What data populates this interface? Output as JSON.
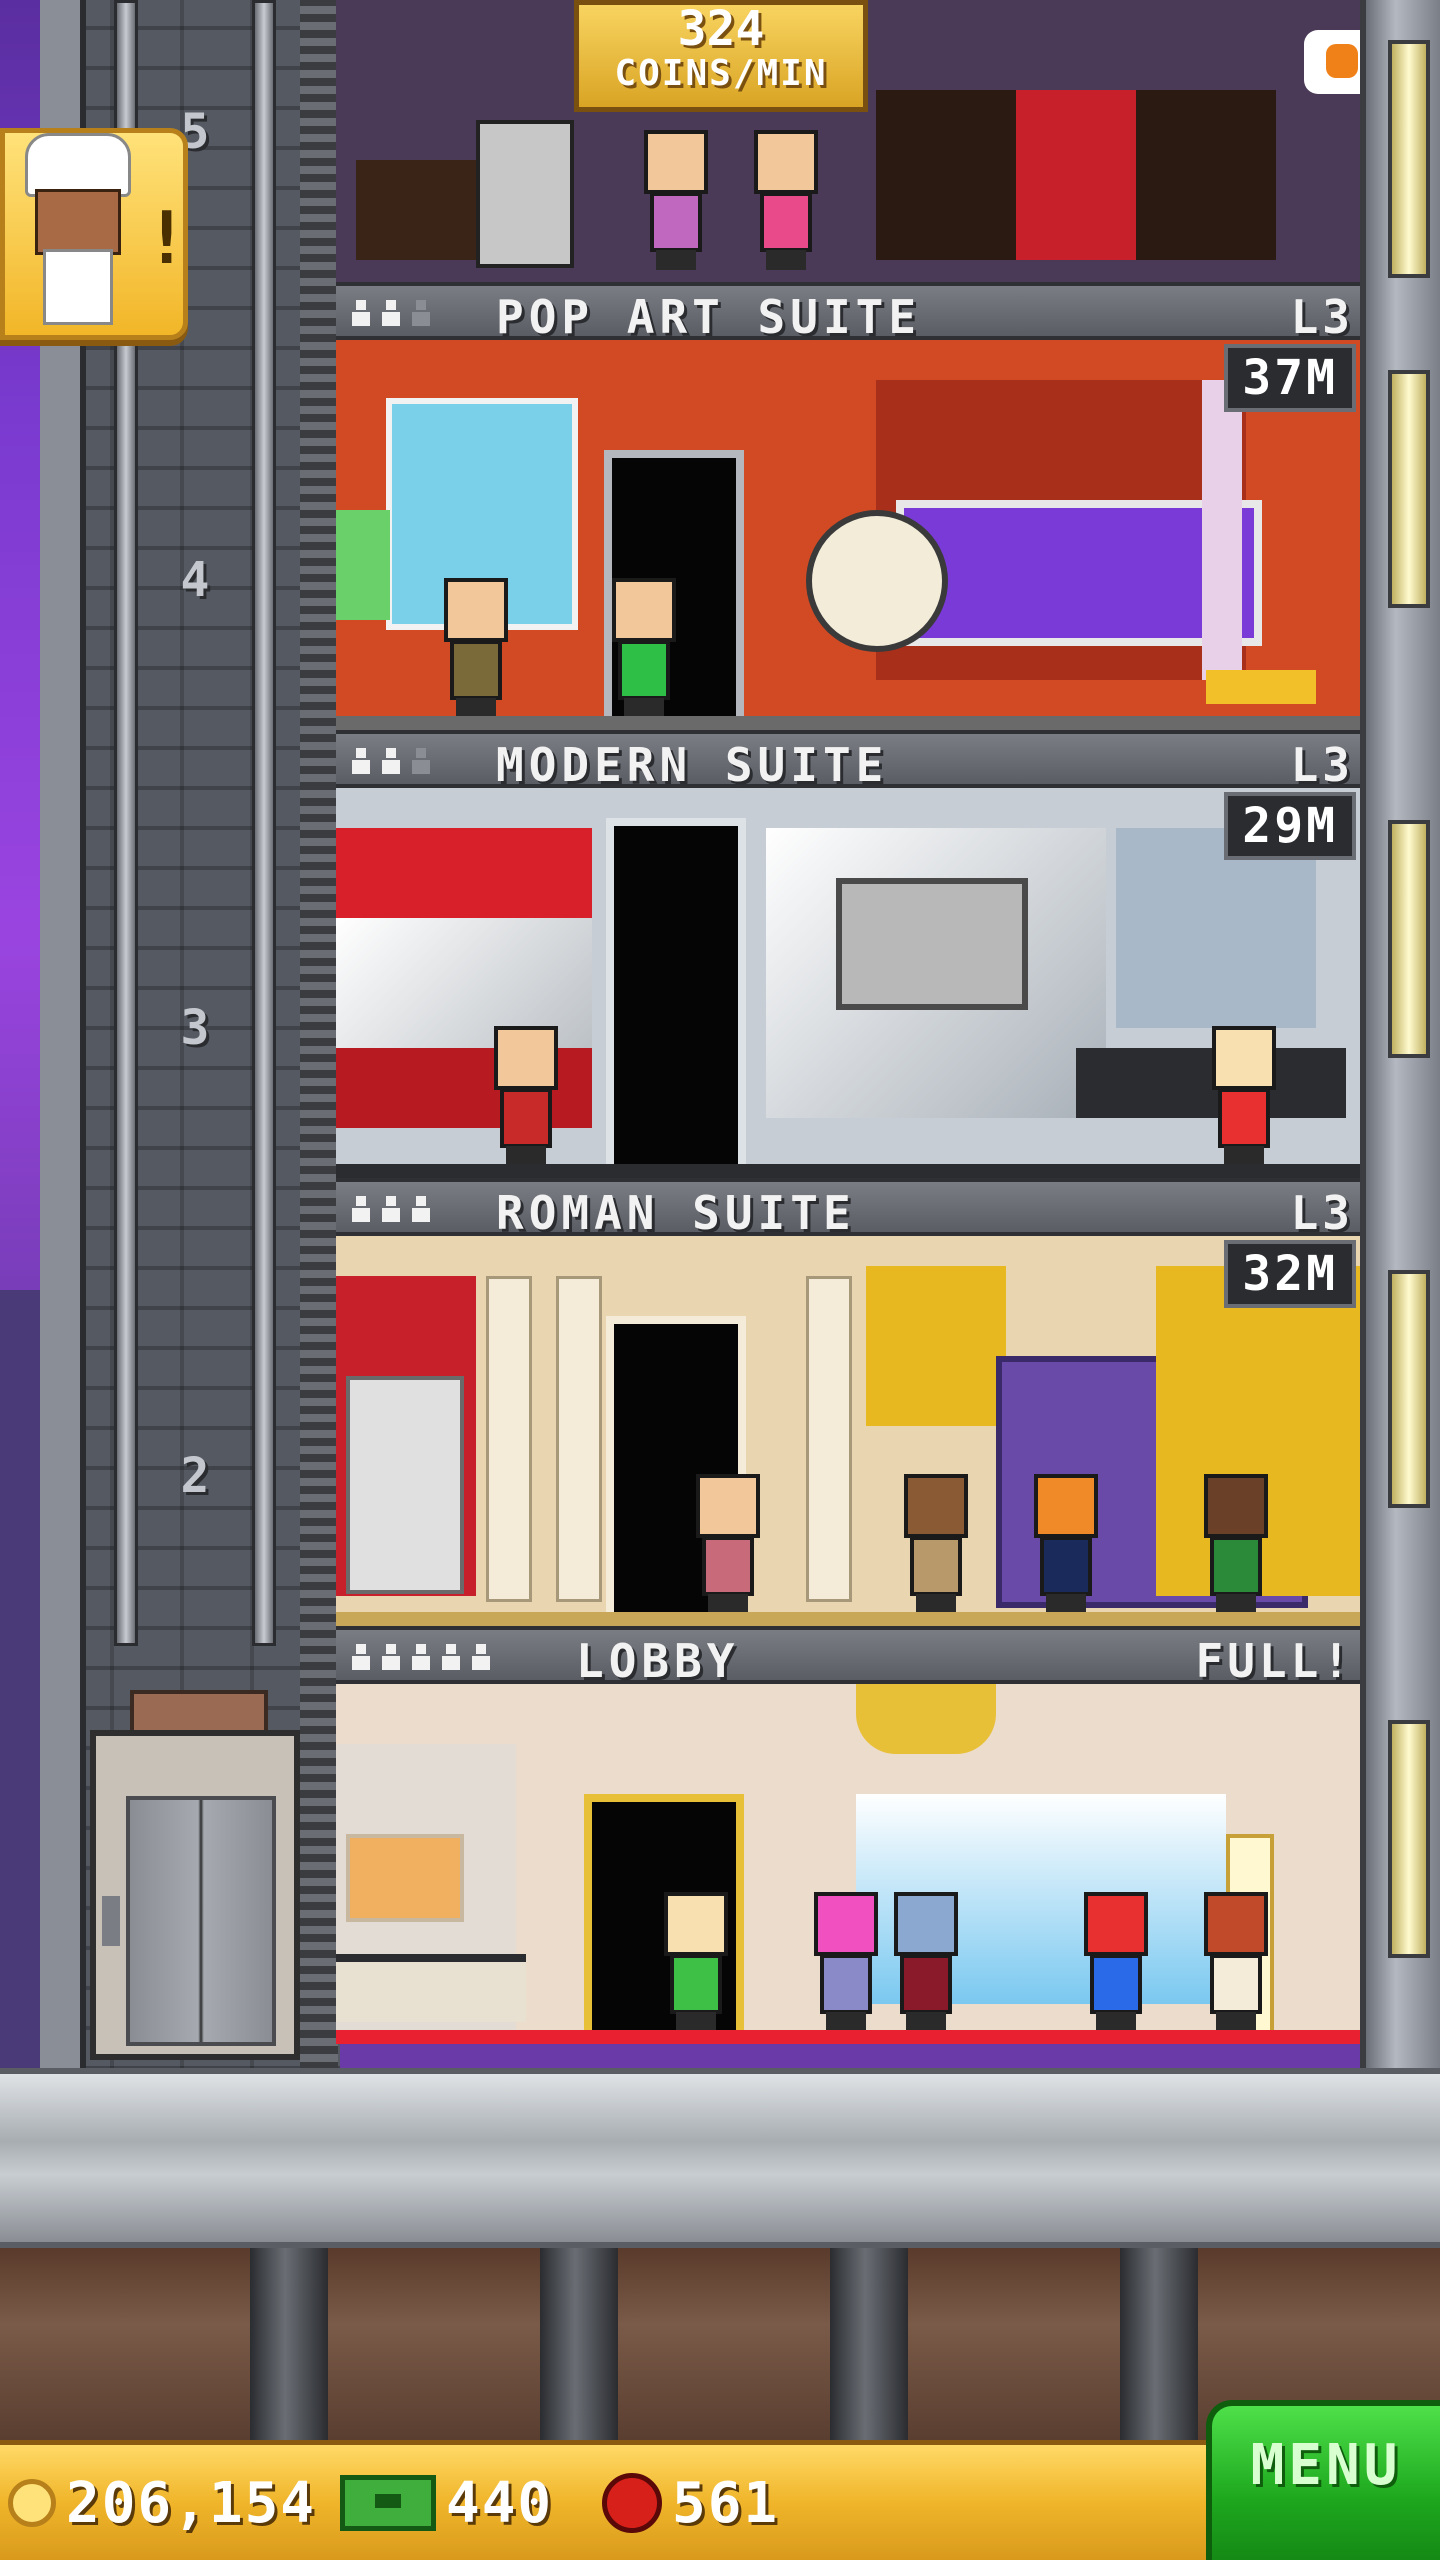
{
  "top_floor": {
    "income_value": "324",
    "income_unit": "COINS/MIN"
  },
  "elevator": {
    "floor_numbers": [
      "5",
      "4",
      "3",
      "2"
    ]
  },
  "floors": [
    {
      "name": "POP ART SUITE",
      "level": "L3",
      "timer": "37M",
      "occupancy": [
        true,
        true,
        false
      ]
    },
    {
      "name": "MODERN SUITE",
      "level": "L3",
      "timer": "29M",
      "occupancy": [
        true,
        true,
        false
      ]
    },
    {
      "name": "ROMAN SUITE",
      "level": "L3",
      "timer": "32M",
      "occupancy": [
        true,
        true,
        true
      ]
    },
    {
      "name": "LOBBY",
      "level": "FULL!",
      "occupancy": [
        true,
        true,
        true,
        true,
        true
      ]
    }
  ],
  "status_bar": {
    "coins": "206,154",
    "bux": "440",
    "gems": "561",
    "menu_label": "MENU"
  },
  "icons": {
    "coin": "coin-icon",
    "bux": "tower-bux-icon",
    "gem": "gem-icon",
    "person": "person-icon",
    "chef": "chef-icon"
  },
  "colors": {
    "status_bar": "#f0b52a",
    "menu_button": "#1ea81e",
    "label_bar": "#6a6e74",
    "popart_wall": "#d24a24",
    "modern_wall": "#c6cdd4",
    "roman_wall": "#e9d6b0",
    "lobby_wall": "#ecdccb"
  }
}
